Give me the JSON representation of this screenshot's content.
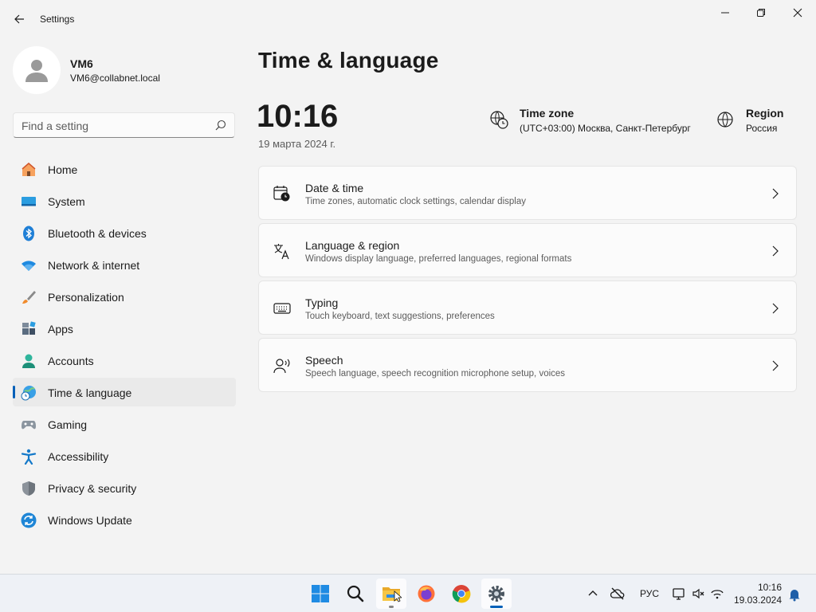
{
  "window": {
    "title": "Settings",
    "controls": {
      "minimize": "minimize",
      "maximize": "maximize",
      "close": "close"
    }
  },
  "profile": {
    "name": "VM6",
    "email": "VM6@collabnet.local"
  },
  "search": {
    "placeholder": "Find a setting"
  },
  "sidebar": {
    "items": [
      {
        "label": "Home",
        "icon": "home-icon"
      },
      {
        "label": "System",
        "icon": "system-icon"
      },
      {
        "label": "Bluetooth & devices",
        "icon": "bluetooth-icon"
      },
      {
        "label": "Network & internet",
        "icon": "wifi-icon"
      },
      {
        "label": "Personalization",
        "icon": "brush-icon"
      },
      {
        "label": "Apps",
        "icon": "apps-icon"
      },
      {
        "label": "Accounts",
        "icon": "accounts-icon"
      },
      {
        "label": "Time & language",
        "icon": "time-language-icon",
        "active": true
      },
      {
        "label": "Gaming",
        "icon": "gamepad-icon"
      },
      {
        "label": "Accessibility",
        "icon": "accessibility-icon"
      },
      {
        "label": "Privacy & security",
        "icon": "shield-icon"
      },
      {
        "label": "Windows Update",
        "icon": "update-icon"
      }
    ]
  },
  "main": {
    "title": "Time & language",
    "clock": "10:16",
    "date": "19 марта 2024 г.",
    "timezone": {
      "title": "Time zone",
      "value": "(UTC+03:00) Москва, Санкт-Петербург"
    },
    "region": {
      "title": "Region",
      "value": "Россия"
    },
    "cards": [
      {
        "title": "Date & time",
        "subtitle": "Time zones, automatic clock settings, calendar display",
        "icon": "calendar-clock-icon"
      },
      {
        "title": "Language & region",
        "subtitle": "Windows display language, preferred languages, regional formats",
        "icon": "language-icon"
      },
      {
        "title": "Typing",
        "subtitle": "Touch keyboard, text suggestions, preferences",
        "icon": "keyboard-icon"
      },
      {
        "title": "Speech",
        "subtitle": "Speech language, speech recognition microphone setup, voices",
        "icon": "speech-icon"
      }
    ]
  },
  "taskbar": {
    "apps": [
      "start-icon",
      "search-icon",
      "file-explorer-icon",
      "firefox-icon",
      "chrome-icon",
      "settings-icon"
    ],
    "tray": {
      "language": "РУС",
      "time": "10:16",
      "date": "19.03.2024"
    }
  },
  "colors": {
    "accent": "#005fb8",
    "background": "#f3f3f3",
    "card": "#fbfbfb"
  }
}
